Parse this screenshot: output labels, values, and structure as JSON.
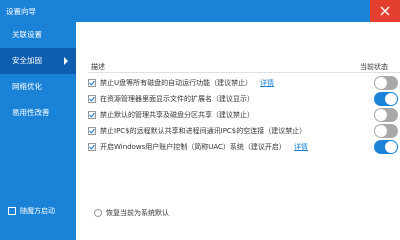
{
  "window": {
    "title": "设置向导"
  },
  "sidebar": {
    "items": [
      {
        "label": "关联设置",
        "active": false
      },
      {
        "label": "安全加固",
        "active": true
      },
      {
        "label": "网络优化",
        "active": false
      },
      {
        "label": "易用性改善",
        "active": false
      }
    ],
    "startup_label": "随魔方启动",
    "startup_checked": false
  },
  "content": {
    "header_desc": "描述",
    "header_status": "当前状态",
    "rows": [
      {
        "checked": true,
        "label": "禁止U盘等所有磁盘的自动运行功能（建议禁止）",
        "link": "详情",
        "state": "off"
      },
      {
        "checked": true,
        "label": "在资源管理器里面显示文件的扩展名（建议显示）",
        "link": "",
        "state": "on"
      },
      {
        "checked": true,
        "label": "禁止默认的管理共享及磁盘分区共享（建议禁止）",
        "link": "",
        "state": "off"
      },
      {
        "checked": true,
        "label": "禁止IPC$的远程默认共享和进程间通讯IPC$的空连接（建议禁止）",
        "link": "",
        "state": "off"
      },
      {
        "checked": true,
        "label": "开启Windows用户账户控制（简称UAC）系统（建议开启）",
        "link": "详情",
        "state": "on"
      }
    ],
    "restore_label": "恢复当前为系统默认"
  },
  "colors": {
    "accent": "#1a83d8",
    "active_nav": "#0d5eae",
    "close": "#e5402f",
    "toggle_off": "#a8a8a8"
  },
  "icons": {
    "close": "close-icon",
    "nav_arrow": "chevron-right-icon",
    "check": "check-icon"
  }
}
